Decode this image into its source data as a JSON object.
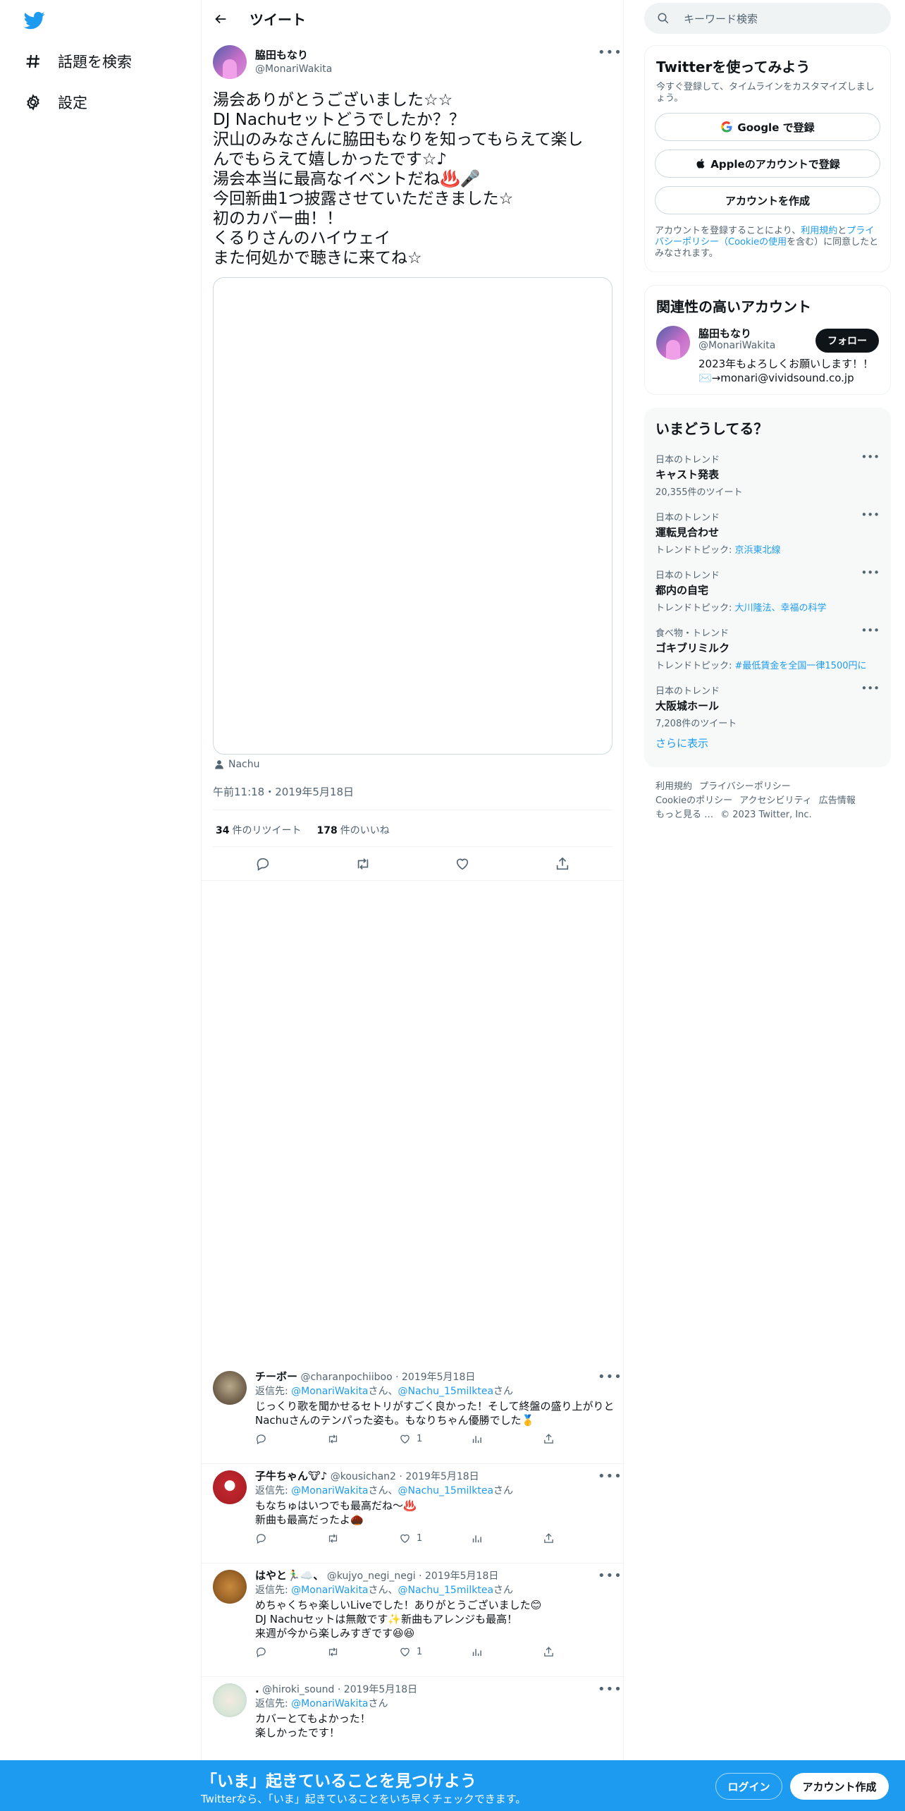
{
  "nav": {
    "explore_label": "話題を検索",
    "settings_label": "設定"
  },
  "header": {
    "title": "ツイート"
  },
  "tweet": {
    "author_name": "脇田もなり",
    "author_handle": "@MonariWakita",
    "text": "湯会ありがとうございました☆☆\nDJ Nachuセットどうでしたか？？\n沢山のみなさんに脇田もなりを知ってもらえて楽し\nんでもらえて嬉しかったです☆♪\n湯会本当に最高なイベントだね♨️🎤\n今回新曲1つ披露させていただきました☆\n初のカバー曲！！\nくるりさんのハイウェイ\nまた何処かで聴きに来てね☆",
    "tagged_user": "Nachu",
    "timestamp": "午前11:18・2019年5月18日",
    "retweet_count": "34",
    "retweet_label": "件のリツイート",
    "like_count": "178",
    "like_label": "件のいいね"
  },
  "replies": [
    {
      "name": "チーボー",
      "handle": "@charanpochiiboo",
      "date": "2019年5月18日",
      "reply_prefix": "返信先: ",
      "to1": "@MonariWakita",
      "san1": "さん、",
      "to2": "@Nachu_15milktea",
      "san2": "さん",
      "text": "じっくり歌を聞かせるセトリがすごく良かった！そして終盤の盛り上がりとNachuさんのテンパった姿も。もなりちゃん優勝でした🥇",
      "likes": "1"
    },
    {
      "name": "子牛ちゃん🐮♪",
      "handle": "@kousichan2",
      "date": "2019年5月18日",
      "reply_prefix": "返信先: ",
      "to1": "@MonariWakita",
      "san1": "さん、",
      "to2": "@Nachu_15milktea",
      "san2": "さん",
      "text": "もなちゅはいつでも最高だね〜♨️\n新曲も最高だったよ🌰",
      "likes": "1"
    },
    {
      "name": "はやと🏃‍♂️☁️、",
      "handle": "@kujyo_negi_negi",
      "date": "2019年5月18日",
      "reply_prefix": "返信先: ",
      "to1": "@MonariWakita",
      "san1": "さん、",
      "to2": "@Nachu_15milktea",
      "san2": "さん",
      "text": "めちゃくちゃ楽しいLiveでした！ありがとうございました😊\nDJ Nachuセットは無敵です✨新曲もアレンジも最高！\n来週が今から楽しみすぎです😆😆",
      "likes": "1"
    },
    {
      "name": ".",
      "handle": "@hiroki_sound",
      "date": "2019年5月18日",
      "reply_prefix": "返信先: ",
      "to1": "@MonariWakita",
      "san1": "さん",
      "to2": "",
      "san2": "",
      "text": "カバーとてもよかった！\n楽しかったです！",
      "likes": ""
    }
  ],
  "search": {
    "placeholder": "キーワード検索"
  },
  "signup_card": {
    "title": "Twitterを使ってみよう",
    "subtitle": "今すぐ登録して、タイムラインをカスタマイズしましょう。",
    "google_button": "Google で登録",
    "apple_button": "Appleのアカウントで登録",
    "create_button": "アカウントを作成",
    "legal_pre": "アカウントを登録することにより、",
    "legal_terms": "利用規約",
    "legal_and": "と",
    "legal_privacy": "プライバシーポリシー",
    "legal_cookie": "（Cookieの使用",
    "legal_post": "を含む）に同意したとみなされます。"
  },
  "related": {
    "title": "関連性の高いアカウント",
    "name": "脇田もなり",
    "handle": "@MonariWakita",
    "follow_label": "フォロー",
    "bio": "2023年もよろしくお願いします！！\n✉️→monari@vividsound.co.jp"
  },
  "trends": {
    "title": "いまどうしてる？",
    "items": [
      {
        "context": "日本のトレンド",
        "name": "キャスト発表",
        "meta": "20,355件のツイート",
        "topic": ""
      },
      {
        "context": "日本のトレンド",
        "name": "運転見合わせ",
        "meta": "トレンドトピック: ",
        "topic": "京浜東北線"
      },
      {
        "context": "日本のトレンド",
        "name": "都内の自宅",
        "meta": "トレンドトピック: ",
        "topic": "大川隆法、幸福の科学"
      },
      {
        "context": "食べ物・トレンド",
        "name": "ゴキブリミルク",
        "meta": "トレンドトピック: ",
        "topic": "#最低賃金を全国一律1500円に"
      },
      {
        "context": "日本のトレンド",
        "name": "大阪城ホール",
        "meta": "7,208件のツイート",
        "topic": ""
      }
    ],
    "show_more": "さらに表示"
  },
  "footer": {
    "terms": "利用規約",
    "privacy": "プライバシーポリシー",
    "cookie": "Cookieのポリシー",
    "accessibility": "アクセシビリティ",
    "ads": "広告情報",
    "more": "もっと見る …",
    "copyright": "© 2023 Twitter, Inc."
  },
  "bottom_bar": {
    "headline": "「いま」起きていることを見つけよう",
    "subline": "Twitterなら、「いま」起きていることをいち早くチェックできます。",
    "login": "ログイン",
    "signup": "アカウント作成"
  },
  "colors": {
    "accent": "#1d9bf0",
    "text": "#0f1419",
    "muted": "#536471"
  }
}
